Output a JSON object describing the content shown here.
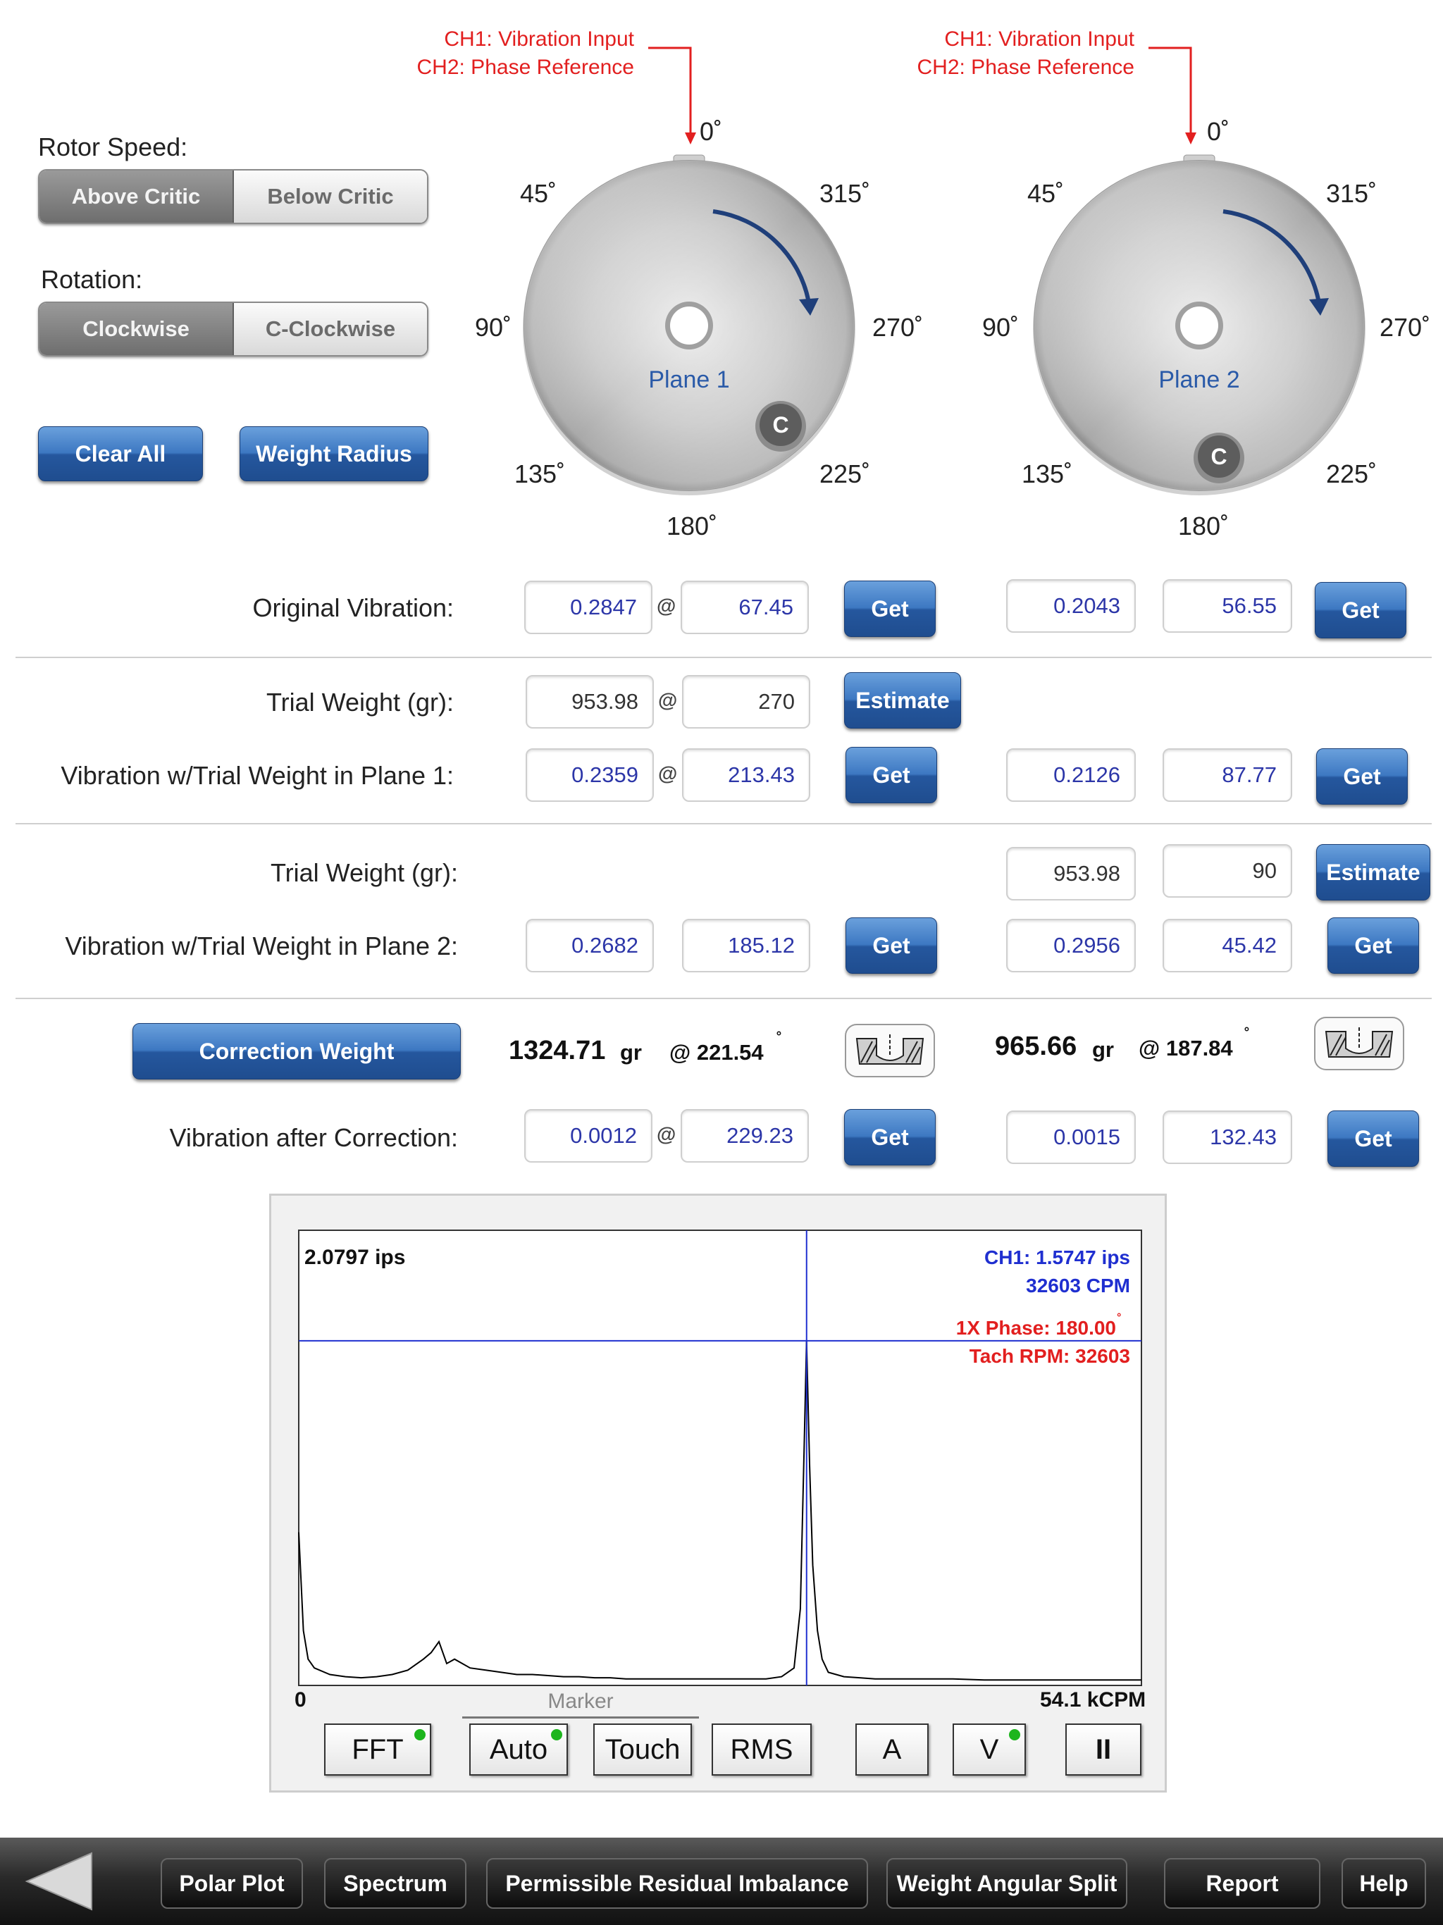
{
  "controls": {
    "rotor_speed_label": "Rotor Speed:",
    "rotor_options": [
      "Above Critic",
      "Below Critic"
    ],
    "rotor_selected": "Above Critic",
    "rotation_label": "Rotation:",
    "rotation_options": [
      "Clockwise",
      "C-Clockwise"
    ],
    "rotation_selected": "Clockwise",
    "clear_all": "Clear All",
    "weight_radius": "Weight Radius"
  },
  "disks": [
    {
      "note_line1": "CH1: Vibration Input",
      "note_line2": "CH2: Phase Reference",
      "plane_label": "Plane 1",
      "angles": {
        "a0": "0˚",
        "a45": "45˚",
        "a315": "315˚",
        "a90": "90˚",
        "a270": "270˚",
        "a135": "135˚",
        "a225": "225˚",
        "a180": "180˚"
      },
      "marker": "C"
    },
    {
      "note_line1": "CH1: Vibration Input",
      "note_line2": "CH2: Phase Reference",
      "plane_label": "Plane 2",
      "angles": {
        "a0": "0˚",
        "a45": "45˚",
        "a315": "315˚",
        "a90": "90˚",
        "a270": "270˚",
        "a135": "135˚",
        "a225": "225˚",
        "a180": "180˚"
      },
      "marker": "C"
    }
  ],
  "rows": {
    "original_vibration": {
      "label": "Original Vibration:",
      "p1_amp": "0.2847",
      "p1_phase": "67.45",
      "p2_amp": "0.2043",
      "p2_phase": "56.55"
    },
    "trial_weight_1": {
      "label": "Trial Weight (gr):",
      "weight": "953.98",
      "angle": "270"
    },
    "vib_trial_1": {
      "label": "Vibration w/Trial Weight in Plane 1:",
      "p1_amp": "0.2359",
      "p1_phase": "213.43",
      "p2_amp": "0.2126",
      "p2_phase": "87.77"
    },
    "trial_weight_2": {
      "label": "Trial Weight (gr):",
      "weight": "953.98",
      "angle": "90"
    },
    "vib_trial_2": {
      "label": "Vibration w/Trial Weight in Plane 2:",
      "p1_amp": "0.2682",
      "p1_phase": "185.12",
      "p2_amp": "0.2956",
      "p2_phase": "45.42"
    },
    "correction": {
      "button": "Correction Weight",
      "p1_weight": "1324.71",
      "p1_unit": "gr",
      "p1_angle": "@ 221.54",
      "p2_weight": "965.66",
      "p2_unit": "gr",
      "p2_angle": "@ 187.84",
      "deg": "˚"
    },
    "after_correction": {
      "label": "Vibration after Correction:",
      "p1_amp": "0.0012",
      "p1_phase": "229.23",
      "p2_amp": "0.0015",
      "p2_phase": "132.43"
    }
  },
  "labels": {
    "at": "@",
    "get": "Get",
    "estimate": "Estimate"
  },
  "spectrum": {
    "ymax_label": "2.0797 ips",
    "ch1_line1": "CH1: 1.5747 ips",
    "ch1_line2": "32603 CPM",
    "phase_line": "1X Phase: 180.00",
    "phase_deg": "˚",
    "tach_line": "Tach RPM: 32603",
    "x_min": "0",
    "x_max": "54.1 kCPM",
    "marker_label": "Marker",
    "colors": {
      "trace": "#000000",
      "cursor": "#1f2fd0",
      "ch1_text": "#1f2fd0",
      "phase_text": "#e21f1f"
    }
  },
  "chart_data": {
    "type": "line",
    "x_unit": "kCPM",
    "xlim": [
      0,
      54.1
    ],
    "y_unit": "ips",
    "ylim": [
      0,
      2.0797
    ],
    "cursor": {
      "x": 32.603,
      "y": 1.5747
    },
    "series": [
      {
        "name": "CH1",
        "points": [
          [
            0,
            0.7
          ],
          [
            0.3,
            0.25
          ],
          [
            0.6,
            0.12
          ],
          [
            1.0,
            0.08
          ],
          [
            2,
            0.05
          ],
          [
            3,
            0.04
          ],
          [
            4,
            0.035
          ],
          [
            5,
            0.04
          ],
          [
            6,
            0.05
          ],
          [
            7,
            0.07
          ],
          [
            8,
            0.12
          ],
          [
            8.5,
            0.15
          ],
          [
            9,
            0.2
          ],
          [
            9.5,
            0.1
          ],
          [
            10,
            0.12
          ],
          [
            11,
            0.08
          ],
          [
            12,
            0.07
          ],
          [
            13,
            0.06
          ],
          [
            14,
            0.05
          ],
          [
            15,
            0.05
          ],
          [
            16,
            0.045
          ],
          [
            17,
            0.04
          ],
          [
            18,
            0.04
          ],
          [
            19,
            0.035
          ],
          [
            20,
            0.035
          ],
          [
            21,
            0.03
          ],
          [
            22,
            0.03
          ],
          [
            23,
            0.03
          ],
          [
            24,
            0.03
          ],
          [
            25,
            0.03
          ],
          [
            26,
            0.03
          ],
          [
            27,
            0.03
          ],
          [
            28,
            0.03
          ],
          [
            29,
            0.03
          ],
          [
            30,
            0.03
          ],
          [
            31,
            0.04
          ],
          [
            31.8,
            0.08
          ],
          [
            32.2,
            0.35
          ],
          [
            32.45,
            1.1
          ],
          [
            32.6,
            1.5747
          ],
          [
            32.8,
            1.0
          ],
          [
            33.0,
            0.55
          ],
          [
            33.3,
            0.25
          ],
          [
            33.6,
            0.12
          ],
          [
            34,
            0.06
          ],
          [
            35,
            0.04
          ],
          [
            36,
            0.035
          ],
          [
            37,
            0.03
          ],
          [
            38,
            0.03
          ],
          [
            40,
            0.03
          ],
          [
            42,
            0.03
          ],
          [
            44,
            0.025
          ],
          [
            46,
            0.025
          ],
          [
            48,
            0.025
          ],
          [
            50,
            0.025
          ],
          [
            52,
            0.025
          ],
          [
            54.1,
            0.025
          ]
        ]
      }
    ]
  },
  "toolbar": {
    "fft": "FFT",
    "auto": "Auto",
    "touch": "Touch",
    "rms": "RMS",
    "a": "A",
    "v": "V",
    "pause": "II"
  },
  "nav": {
    "polar_plot": "Polar Plot",
    "spectrum": "Spectrum",
    "permissible": "Permissible Residual Imbalance",
    "weight_split": "Weight Angular Split",
    "report": "Report",
    "help": "Help"
  }
}
